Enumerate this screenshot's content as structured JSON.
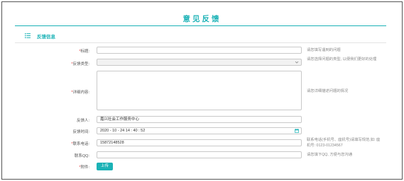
{
  "page": {
    "title": "意见反馈"
  },
  "section": {
    "label": "反馈信息",
    "icon": "list-icon"
  },
  "fields": {
    "title": {
      "label": "标题:",
      "value": "",
      "hint": "请您填写遇到的问题"
    },
    "type": {
      "label": "反馈类型:",
      "value": "",
      "hint": "请您选择问题的类型, 以便我们更好的处理"
    },
    "detail": {
      "label": "详细内容:",
      "value": "",
      "hint": "请您详细描述问题的情况"
    },
    "person": {
      "label": "反馈人:",
      "value": "嘉兴社会工作服务中心"
    },
    "time": {
      "label": "反馈时间:",
      "value": "2020 - 10 - 24  14 : 40 : 52"
    },
    "phone": {
      "label": "联系电话:",
      "value": "15872148528",
      "hint": "联系电话(手机号、座机号)请填写规范,如: 座机号: 0123-01234567"
    },
    "qq": {
      "label": "联系QQ:",
      "value": "",
      "hint": "请您填下QQ, 方便与您沟通"
    },
    "attachment": {
      "label": "附件:",
      "button": "上传"
    }
  },
  "colors": {
    "accent": "#1bb2b6",
    "required": "#e23b3b"
  }
}
